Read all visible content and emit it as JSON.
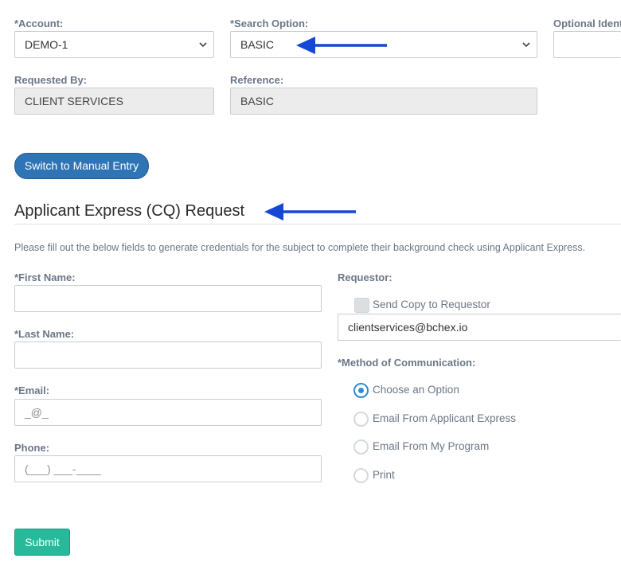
{
  "top": {
    "account": {
      "label": "*Account:",
      "value": "DEMO-1"
    },
    "search_option": {
      "label": "*Search Option:",
      "value": "BASIC"
    },
    "optional_identifier": {
      "label": "Optional Ident"
    },
    "requested_by": {
      "label": "Requested By:",
      "value": "CLIENT SERVICES"
    },
    "reference": {
      "label": "Reference:",
      "value": "BASIC"
    }
  },
  "switch_button": {
    "label": "Switch to Manual Entry"
  },
  "section": {
    "title": "Applicant Express (CQ) Request",
    "description": "Please fill out the below fields to generate credentials for the subject to complete their background check using Applicant Express."
  },
  "form": {
    "first_name": {
      "label": "*First Name:",
      "value": ""
    },
    "last_name": {
      "label": "*Last Name:",
      "value": ""
    },
    "email": {
      "label": "*Email:",
      "mask": "_@_"
    },
    "phone": {
      "label": "Phone:",
      "mask": "(___) ___-____"
    },
    "requestor": {
      "label": "Requestor:",
      "send_copy_label": "Send Copy to Requestor",
      "email": "clientservices@bchex.io"
    },
    "method": {
      "label": "*Method of Communication:",
      "options": [
        {
          "label": "Choose an Option",
          "selected": true
        },
        {
          "label": "Email From Applicant Express",
          "selected": false
        },
        {
          "label": "Email From My Program",
          "selected": false
        },
        {
          "label": "Print",
          "selected": false
        }
      ]
    },
    "submit_label": "Submit"
  },
  "colors": {
    "primary_button": "#2f74b5",
    "submit_button": "#26b99a",
    "arrow": "#1447d6",
    "radio_selected": "#2f8bd6",
    "label_text": "#6b7787"
  }
}
